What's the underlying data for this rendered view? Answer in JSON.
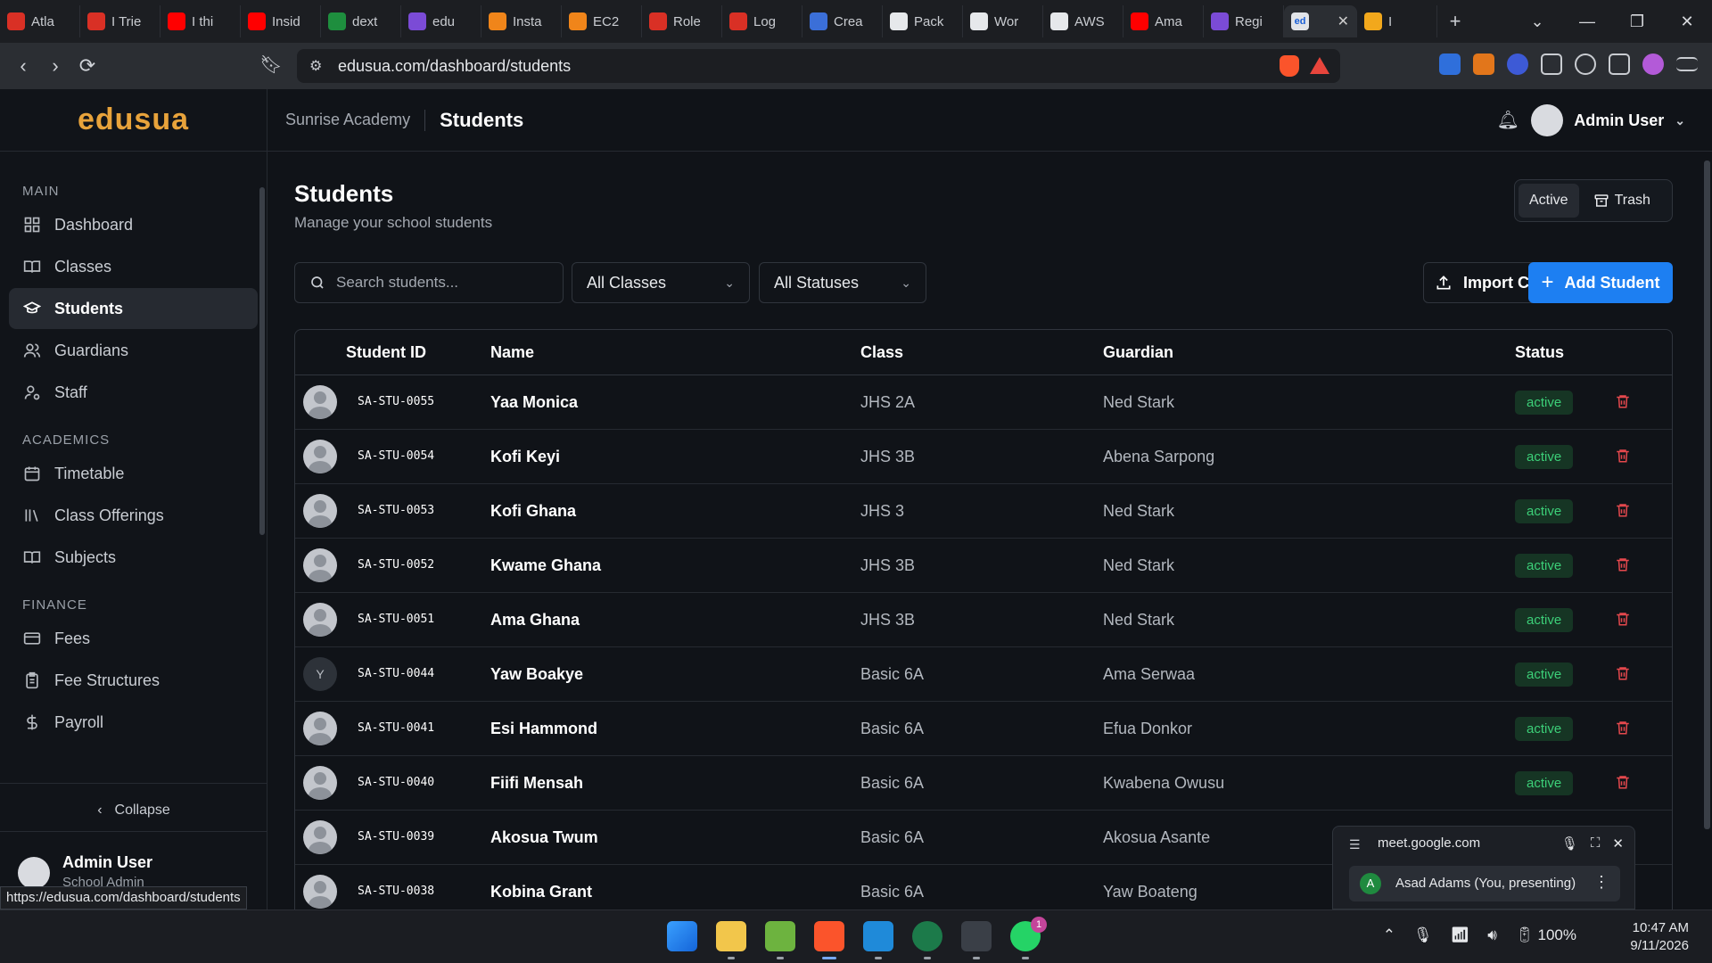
{
  "browser": {
    "tabs": [
      {
        "label": "Atla",
        "color": "#d93025"
      },
      {
        "label": "I Trie",
        "color": "#d93025"
      },
      {
        "label": "I thi",
        "color": "#ff0000"
      },
      {
        "label": "Insid",
        "color": "#ff0000"
      },
      {
        "label": "dext",
        "color": "#1e8e3e"
      },
      {
        "label": "edu",
        "color": "#7b4bd6"
      },
      {
        "label": "Insta",
        "color": "#f0851a"
      },
      {
        "label": "EC2",
        "color": "#f0851a"
      },
      {
        "label": "Role",
        "color": "#d93025"
      },
      {
        "label": "Log",
        "color": "#d93025"
      },
      {
        "label": "Crea",
        "color": "#3b6fd8"
      },
      {
        "label": "Pack",
        "color": "#e6e8eb"
      },
      {
        "label": "Wor",
        "color": "#e6e8eb"
      },
      {
        "label": "AWS",
        "color": "#e6e8eb"
      },
      {
        "label": "Ama",
        "color": "#ff0000"
      },
      {
        "label": "Regi",
        "color": "#7b4bd6"
      }
    ],
    "active_tab_icon": "ed",
    "extra_tab_label": "I",
    "url": "edusua.com/dashboard/students",
    "status_url": "https://edusua.com/dashboard/students"
  },
  "app": {
    "logo": "edusua",
    "breadcrumb_school": "Sunrise Academy",
    "breadcrumb_page": "Students",
    "user_name": "Admin User",
    "user_role": "School Admin",
    "collapse_label": "Collapse"
  },
  "sidebar": {
    "sections": [
      {
        "title": "MAIN",
        "items": [
          {
            "label": "Dashboard",
            "icon": "grid-icon"
          },
          {
            "label": "Classes",
            "icon": "book-open-icon"
          },
          {
            "label": "Students",
            "icon": "graduation-cap-icon",
            "active": true
          },
          {
            "label": "Guardians",
            "icon": "users-icon"
          },
          {
            "label": "Staff",
            "icon": "user-cog-icon"
          }
        ]
      },
      {
        "title": "ACADEMICS",
        "items": [
          {
            "label": "Timetable",
            "icon": "calendar-icon"
          },
          {
            "label": "Class Offerings",
            "icon": "library-icon"
          },
          {
            "label": "Subjects",
            "icon": "book-open-icon"
          }
        ]
      },
      {
        "title": "FINANCE",
        "items": [
          {
            "label": "Fees",
            "icon": "credit-card-icon"
          },
          {
            "label": "Fee Structures",
            "icon": "clipboard-icon"
          },
          {
            "label": "Payroll",
            "icon": "dollar-icon"
          }
        ]
      }
    ]
  },
  "page": {
    "title": "Students",
    "subtitle": "Manage your school students",
    "toggle_active": "Active",
    "toggle_trash": "Trash",
    "search_placeholder": "Search students...",
    "class_filter": "All Classes",
    "status_filter": "All Statuses",
    "import_label": "Import CSV",
    "add_label": "Add Student"
  },
  "table": {
    "headers": {
      "id": "Student ID",
      "name": "Name",
      "class": "Class",
      "guardian": "Guardian",
      "status": "Status"
    },
    "rows": [
      {
        "id": "SA-STU-0055",
        "name": "Yaa Monica",
        "class": "JHS 2A",
        "guardian": "Ned Stark",
        "status": "active"
      },
      {
        "id": "SA-STU-0054",
        "name": "Kofi Keyi",
        "class": "JHS 3B",
        "guardian": "Abena Sarpong",
        "status": "active"
      },
      {
        "id": "SA-STU-0053",
        "name": "Kofi Ghana",
        "class": "JHS 3",
        "guardian": "Ned Stark",
        "status": "active"
      },
      {
        "id": "SA-STU-0052",
        "name": "Kwame Ghana",
        "class": "JHS 3B",
        "guardian": "Ned Stark",
        "status": "active"
      },
      {
        "id": "SA-STU-0051",
        "name": "Ama Ghana",
        "class": "JHS 3B",
        "guardian": "Ned Stark",
        "status": "active"
      },
      {
        "id": "SA-STU-0044",
        "name": "Yaw Boakye",
        "class": "Basic 6A",
        "guardian": "Ama Serwaa",
        "status": "active",
        "initial": "Y"
      },
      {
        "id": "SA-STU-0041",
        "name": "Esi Hammond",
        "class": "Basic 6A",
        "guardian": "Efua Donkor",
        "status": "active"
      },
      {
        "id": "SA-STU-0040",
        "name": "Fiifi Mensah",
        "class": "Basic 6A",
        "guardian": "Kwabena Owusu",
        "status": "active"
      },
      {
        "id": "SA-STU-0039",
        "name": "Akosua Twum",
        "class": "Basic 6A",
        "guardian": "Akosua Asante",
        "status": ""
      },
      {
        "id": "SA-STU-0038",
        "name": "Kobina Grant",
        "class": "Basic 6A",
        "guardian": "Yaw Boateng",
        "status": ""
      }
    ]
  },
  "meet_popup": {
    "host": "meet.google.com",
    "presenter_initial": "A",
    "presenter": "Asad Adams (You, presenting)"
  },
  "taskbar": {
    "battery": "100%",
    "time": "10:47 AM",
    "date": "9/11/2026",
    "whatsapp_badge": "1"
  }
}
